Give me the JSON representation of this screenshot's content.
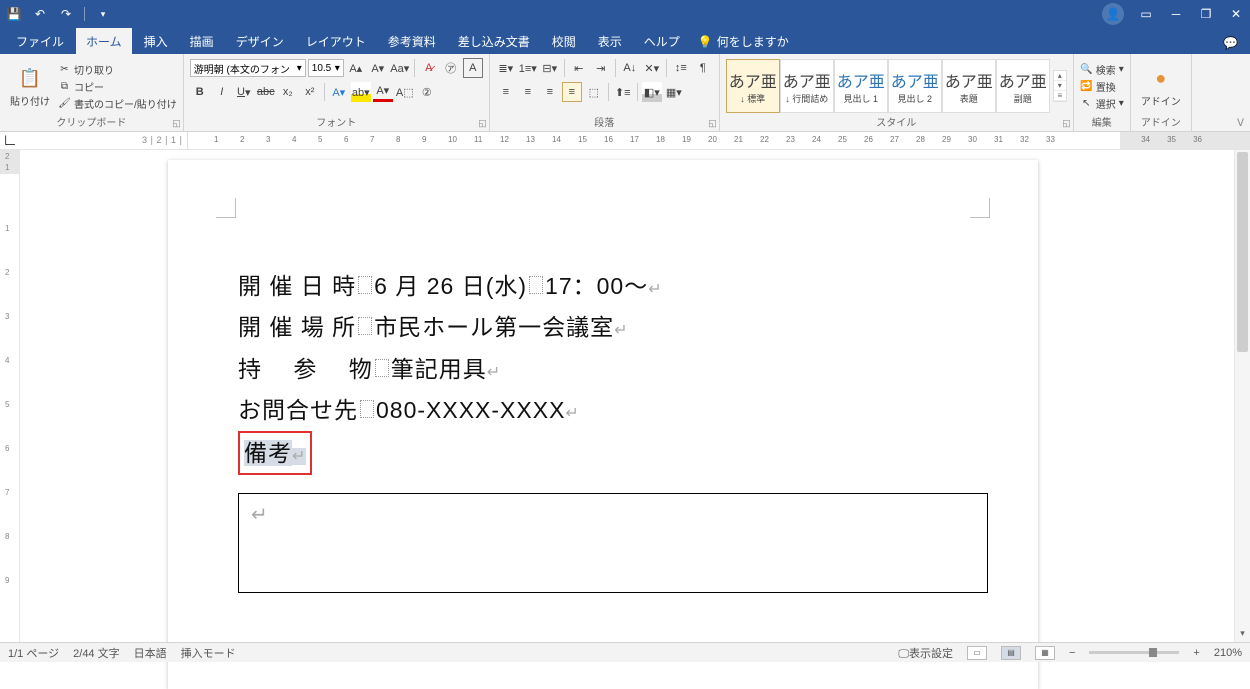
{
  "titlebar": {
    "qat_icons": [
      "save-icon",
      "undo-icon",
      "redo-icon",
      "touch-mode-icon"
    ]
  },
  "window_controls": {
    "account": "account-icon",
    "ribbon_opts": "ribbon-display-icon",
    "min": "minimize-icon",
    "max": "restore-icon",
    "close": "close-icon"
  },
  "tabs": {
    "file": "ファイル",
    "home": "ホーム",
    "insert": "挿入",
    "draw": "描画",
    "design": "デザイン",
    "layout": "レイアウト",
    "references": "参考資料",
    "mailings": "差し込み文書",
    "review": "校閲",
    "view": "表示",
    "help": "ヘルプ",
    "tellme": "何をしますか"
  },
  "ribbon": {
    "clipboard": {
      "paste": "貼り付け",
      "cut": "切り取り",
      "copy": "コピー",
      "format_painter": "書式のコピー/貼り付け",
      "label": "クリップボード"
    },
    "font": {
      "family": "游明朝 (本文のフォン",
      "size": "10.5",
      "label": "フォント"
    },
    "paragraph": {
      "label": "段落"
    },
    "styles": {
      "label": "スタイル",
      "items": [
        {
          "preview": "あア亜",
          "name": "↓ 標準",
          "cls": ""
        },
        {
          "preview": "あア亜",
          "name": "↓ 行間詰め",
          "cls": ""
        },
        {
          "preview": "あア亜",
          "name": "見出し 1",
          "cls": "blue"
        },
        {
          "preview": "あア亜",
          "name": "見出し 2",
          "cls": "blue"
        },
        {
          "preview": "あア亜",
          "name": "表題",
          "cls": ""
        },
        {
          "preview": "あア亜",
          "name": "副題",
          "cls": ""
        }
      ]
    },
    "editing": {
      "find": "検索",
      "replace": "置換",
      "select": "選択",
      "label": "編集"
    },
    "addins": {
      "btn": "アドイン",
      "label": "アドイン"
    }
  },
  "document": {
    "lines": {
      "l1a": "開 催 日 時",
      "l1b": "6 月 26 日(水)",
      "l1c": "17：00～",
      "l2a": "開 催 場 所",
      "l2b": "市民ホール第一会議室",
      "l3a": "持　 参　 物",
      "l3b": "筆記用具",
      "l4a": "お問合せ先",
      "l4b": "080-XXXX-XXXX",
      "l5": "備考"
    }
  },
  "status": {
    "page": "1/1 ページ",
    "words": "2/44 文字",
    "lang": "日本語",
    "mode": "挿入モード",
    "display_settings": "表示設定",
    "zoom": "210%"
  }
}
